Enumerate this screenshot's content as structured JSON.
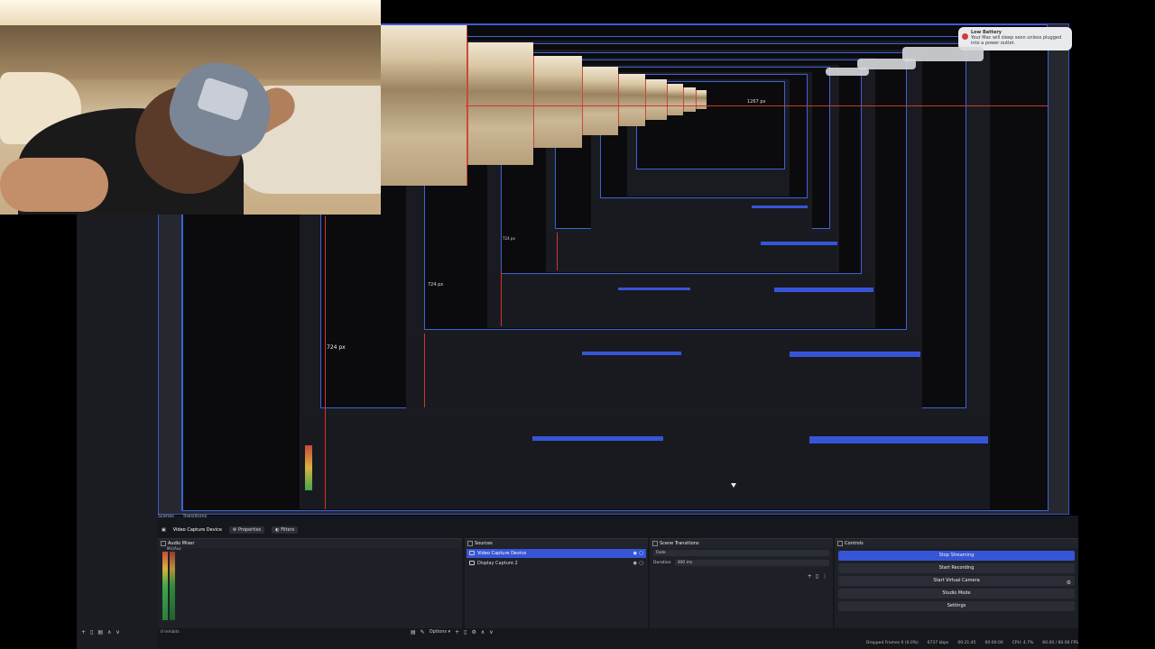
{
  "notification": {
    "title": "Low Battery",
    "body": "Your Mac will sleep soon unless plugged into a power outlet."
  },
  "preview": {
    "size_labels": [
      "724 px",
      "724 px",
      "1267 px",
      "724 px"
    ]
  },
  "dock": {
    "scene_tabs": [
      "Scenes",
      "Transitions"
    ],
    "source_name": "Video Capture Device",
    "properties_label": "Properties",
    "filters_label": "Filters",
    "audio_mixer": {
      "title": "Audio Mixer",
      "channel_label": "Mic/Aux",
      "channel_level": "0.0 dB"
    },
    "sources": {
      "title": "Sources",
      "items": [
        {
          "label": "Video Capture Device",
          "selected": true
        },
        {
          "label": "Display Capture 2",
          "selected": false
        }
      ]
    },
    "transitions": {
      "title": "Scene Transitions",
      "transition_value": "Fade",
      "duration_label": "Duration",
      "duration_value": "300 ms"
    },
    "controls": {
      "title": "Controls",
      "buttons": [
        {
          "label": "Stop Streaming",
          "primary": true
        },
        {
          "label": "Start Recording",
          "primary": false
        },
        {
          "label": "Start Virtual Camera",
          "primary": false
        },
        {
          "label": "Studio Mode",
          "primary": false
        },
        {
          "label": "Settings",
          "primary": false
        }
      ]
    },
    "footer": {
      "options_label": "Options",
      "audio_footer": "0 Inhibits"
    },
    "status": {
      "dropped_frames": "Dropped Frames 0 (0.0%)",
      "bitrate": "6737 kbps",
      "live_time": "00:21:45",
      "rec_time": "00:00:00",
      "cpu": "CPU: 4.7%",
      "fps": "60.00 / 60.00 FPS"
    }
  },
  "colors": {
    "accent": "#3655d6",
    "preview_border": "#3d62d6",
    "guide_red": "#d3342a",
    "panel_bg": "#1e2027"
  }
}
